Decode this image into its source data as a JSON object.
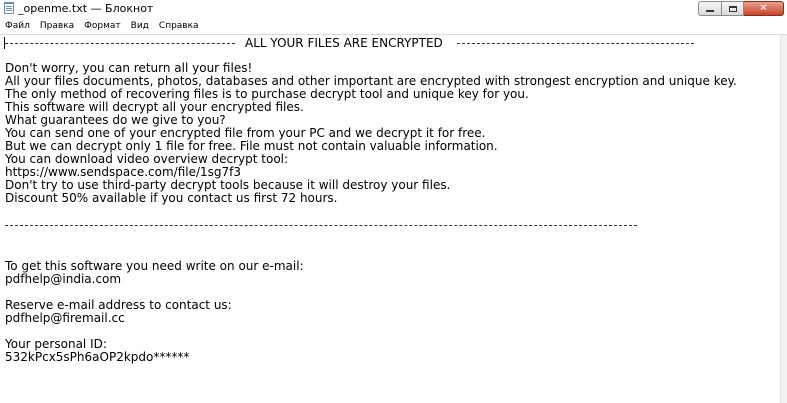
{
  "window": {
    "title": "_openme.txt — Блокнот",
    "icon": "notepad-icon"
  },
  "caption_buttons": {
    "minimize_icon": "minimize-icon",
    "maximize_icon": "maximize-icon",
    "close_glyph": "✕"
  },
  "menu": {
    "items": [
      {
        "label": "Файл"
      },
      {
        "label": "Правка"
      },
      {
        "label": "Формат"
      },
      {
        "label": "Вид"
      },
      {
        "label": "Справка"
      }
    ]
  },
  "document": {
    "heading": "ALL YOUR FILES ARE ENCRYPTED",
    "lines": [
      "Don't worry, you can return all your files!",
      "All your files documents, photos, databases and other important are encrypted with strongest encryption and unique key.",
      "The only method of recovering files is to purchase decrypt tool and unique key for you.",
      "This software will decrypt all your encrypted files.",
      "What guarantees do we give to you?",
      "You can send one of your encrypted file from your PC and we decrypt it for free.",
      "But we can decrypt only 1 file for free. File must not contain valuable information.",
      "You can download video overview decrypt tool:",
      "https://www.sendspace.com/file/1sg7f3",
      "Don't try to use third-party decrypt tools because it will destroy your files.",
      "Discount 50% available if you contact us first 72 hours."
    ],
    "contact": {
      "intro": "To get this software you need write on our e-mail:",
      "email_primary": "pdfhelp@india.com",
      "reserve_intro": "Reserve e-mail address to contact us:",
      "email_reserve": "pdfhelp@firemail.cc",
      "id_label": "Your personal ID:",
      "id_value": "532kPcx5sPh6aOP2kpdo******"
    }
  }
}
